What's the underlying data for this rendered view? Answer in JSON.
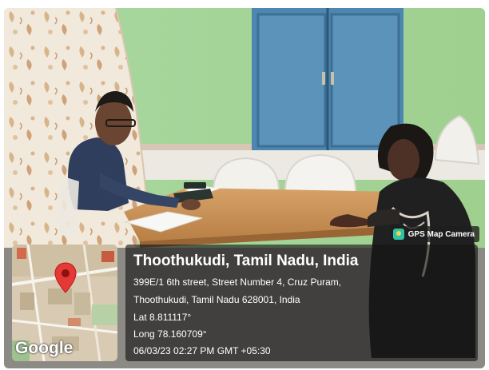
{
  "watermark": {
    "badge_label": "GPS Map Camera",
    "badge_icon": "gps-camera-icon"
  },
  "map": {
    "provider_label": "Google",
    "marker_icon": "map-pin-icon",
    "marker_color": "#e53935"
  },
  "location": {
    "title": "Thoothukudi, Tamil Nadu, India",
    "address_line1": "399E/1 6th street, Street Number 4, Cruz Puram,",
    "address_line2": "Thoothukudi, Tamil Nadu 628001, India",
    "latitude": "Lat 8.811117°",
    "longitude": "Long 78.160709°",
    "timestamp": "06/03/23 02:27 PM GMT +05:30"
  }
}
